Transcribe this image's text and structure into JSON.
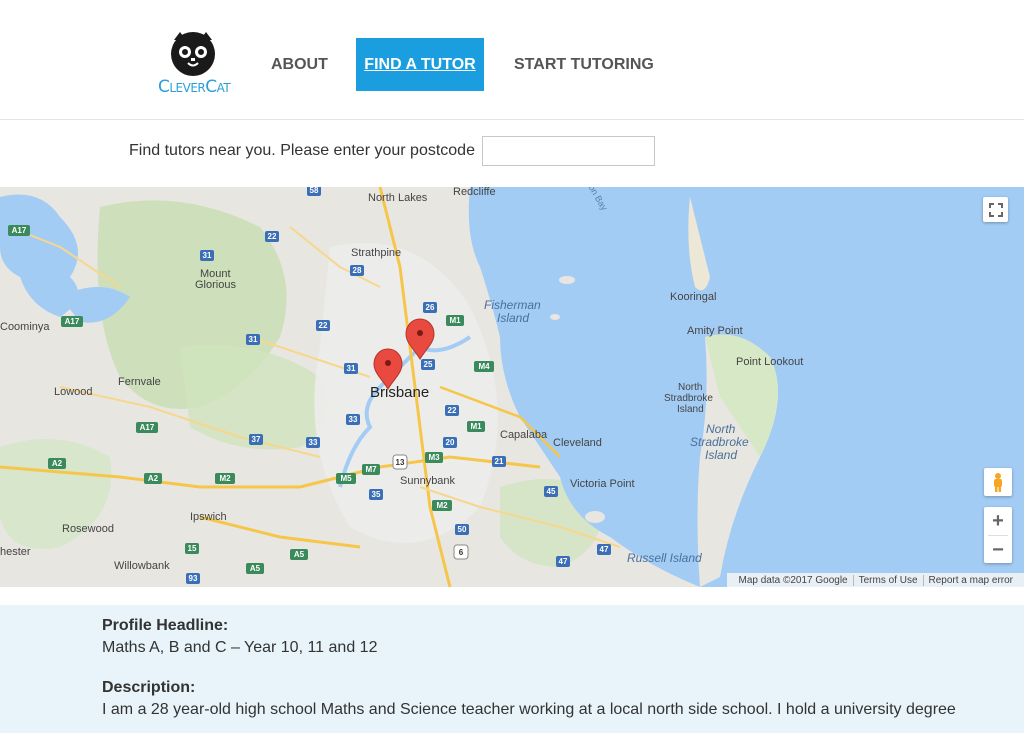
{
  "header": {
    "logo_text": "CleverCat",
    "nav": {
      "about": "ABOUT",
      "find_tutor": "FIND A TUTOR",
      "start_tutoring": "START TUTORING"
    },
    "accent_color": "#1a9ee0"
  },
  "search": {
    "label": "Find tutors near you. Please enter your postcode",
    "value": "",
    "placeholder": ""
  },
  "map": {
    "labels": {
      "north_lakes": "North Lakes",
      "redcliffe": "Redcliffe",
      "strathpine": "Strathpine",
      "mount_glorious": "Mount\nGlorious",
      "fisherman_island": "Fisherman\nIsland",
      "kooringal": "Kooringal",
      "amity_point": "Amity Point",
      "point_lookout": "Point Lookout",
      "coominya": "Coominya",
      "lowood": "Lowood",
      "fernvale": "Fernvale",
      "brisbane": "Brisbane",
      "north_stradbroke_island_sm": "North\nStradbroke\nIsland",
      "north_stradbroke_island": "North\nStradbroke\nIsland",
      "capalaba": "Capalaba",
      "cleveland": "Cleveland",
      "sunnybank": "Sunnybank",
      "victoria_point": "Victoria Point",
      "ipswich": "Ipswich",
      "rosewood": "Rosewood",
      "chester": "hester",
      "willowbank": "Willowbank",
      "russell_island": "Russell Island",
      "on_bay": "on Bay"
    },
    "road_shields": [
      "A17",
      "58",
      "22",
      "31",
      "28",
      "26",
      "M1",
      "22",
      "31",
      "25",
      "M4",
      "31",
      "33",
      "22",
      "A17",
      "M1",
      "37",
      "33",
      "20",
      "A2",
      "M3",
      "M7",
      "13",
      "21",
      "A2",
      "M2",
      "M5",
      "35",
      "45",
      "M2",
      "50",
      "15",
      "A5",
      "6",
      "47",
      "47",
      "A5",
      "93"
    ],
    "footer": {
      "map_data": "Map data ©2017 Google",
      "terms": "Terms of Use",
      "report": "Report a map error"
    },
    "zoom_in": "+",
    "zoom_out": "−",
    "water_color": "#a3ccf5",
    "land_color": "#e8e6e1",
    "marker_color": "#e84a3f"
  },
  "profile": {
    "headline_label": "Profile Headline:",
    "headline_value": "Maths A, B and C – Year 10, 11 and 12",
    "description_label": "Description:",
    "description_value": "I am a 28 year-old high school Maths and Science teacher working at a local north side school. I hold a university degree"
  }
}
